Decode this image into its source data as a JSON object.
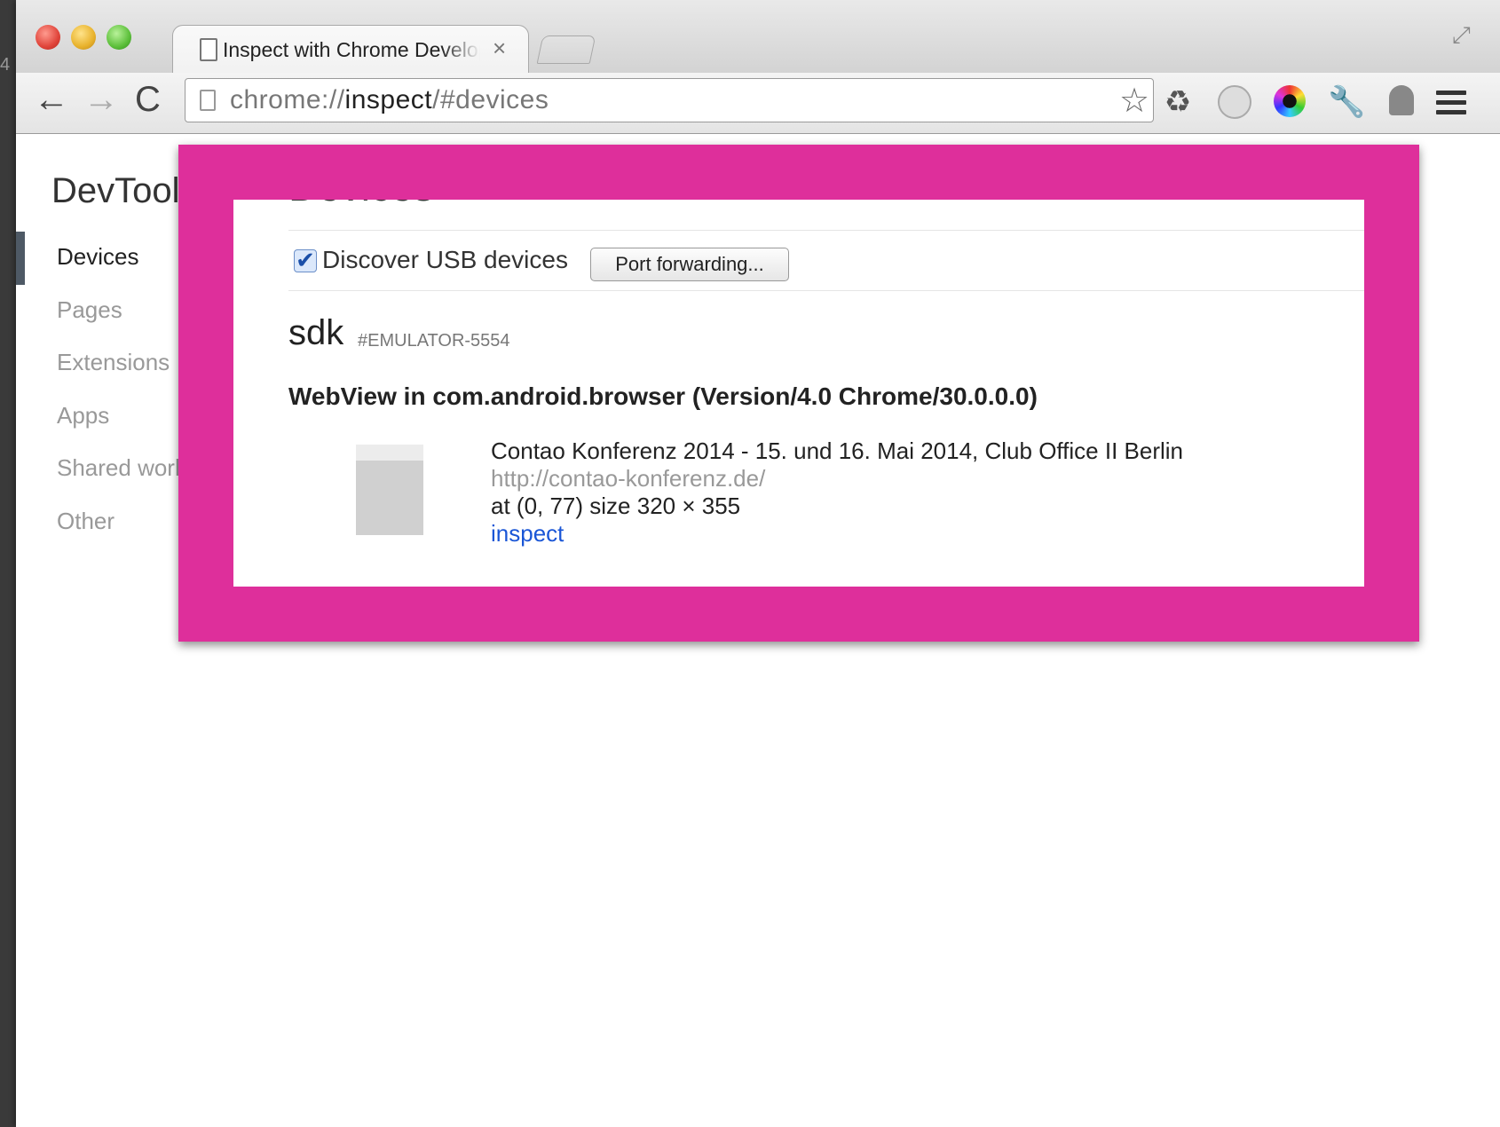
{
  "desktop": {
    "edge_number": "4"
  },
  "tab": {
    "title": "Inspect with Chrome Developer Tools",
    "close_glyph": "×"
  },
  "toolbar": {
    "back": "←",
    "forward": "→",
    "reload": "C",
    "url_scheme": "chrome://",
    "url_host": "inspect",
    "url_path": "/#devices",
    "star": "☆",
    "ext_recycle": "♻",
    "ext_wrench": "🔧"
  },
  "sidebar": {
    "title": "DevTools",
    "items": [
      {
        "label": "Devices",
        "active": true
      },
      {
        "label": "Pages"
      },
      {
        "label": "Extensions"
      },
      {
        "label": "Apps"
      },
      {
        "label": "Shared workers"
      },
      {
        "label": "Other"
      }
    ]
  },
  "main": {
    "heading": "Devices",
    "discover_usb_label": "Discover USB devices",
    "discover_usb_checked": true,
    "port_forwarding_label": "Port forwarding...",
    "device": {
      "name": "sdk",
      "serial": "#EMULATOR-5554",
      "browser": "WebView in com.android.browser (Version/4.0 Chrome/30.0.0.0)",
      "page": {
        "title": "Contao Konferenz 2014 - 15. und 16. Mai 2014, Club Office II Berlin",
        "url": "http://contao-konferenz.de/",
        "geometry": "at (0, 77) size 320 × 355",
        "inspect_label": "inspect"
      }
    }
  },
  "colors": {
    "highlight": "#de2f9b",
    "link": "#1a56d6"
  }
}
